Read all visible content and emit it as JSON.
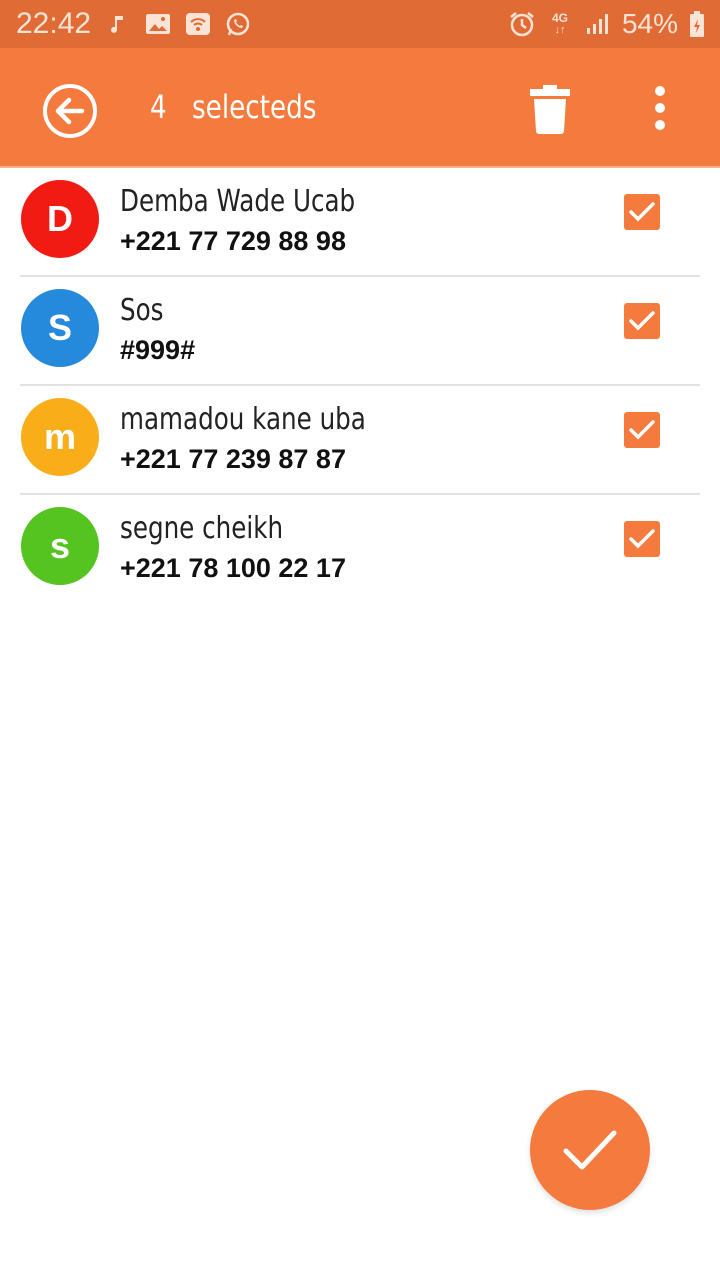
{
  "status_bar": {
    "time": "22:42",
    "left_icons": [
      "music-note-icon",
      "image-icon",
      "wifi-hotspot-icon",
      "whatsapp-icon"
    ],
    "right_icons": [
      "alarm-icon",
      "network-4g-icon",
      "signal-icon",
      "battery-icon"
    ],
    "network": "4G",
    "battery": "54%"
  },
  "app_bar": {
    "selected_count": "4",
    "selected_label": "selecteds",
    "back_icon": "back-arrow-icon",
    "delete_icon": "trash-icon",
    "more_icon": "more-vert-icon"
  },
  "contacts": [
    {
      "initial": "D",
      "name": "Demba Wade Ucab",
      "phone": "+221 77 729 88 98",
      "color": "#f21b14",
      "checked": true
    },
    {
      "initial": "S",
      "name": "Sos",
      "phone": "#999#",
      "color": "#2589dc",
      "checked": true
    },
    {
      "initial": "m",
      "name": "mamadou kane uba",
      "phone": "+221 77 239 87 87",
      "color": "#f9ae19",
      "checked": true
    },
    {
      "initial": "s",
      "name": "segne cheikh",
      "phone": "+221 78 100 22 17",
      "color": "#55c420",
      "checked": true
    }
  ],
  "fab": {
    "icon": "check-icon"
  },
  "colors": {
    "primary": "#f47a3e",
    "status_bar": "#e06b35"
  }
}
